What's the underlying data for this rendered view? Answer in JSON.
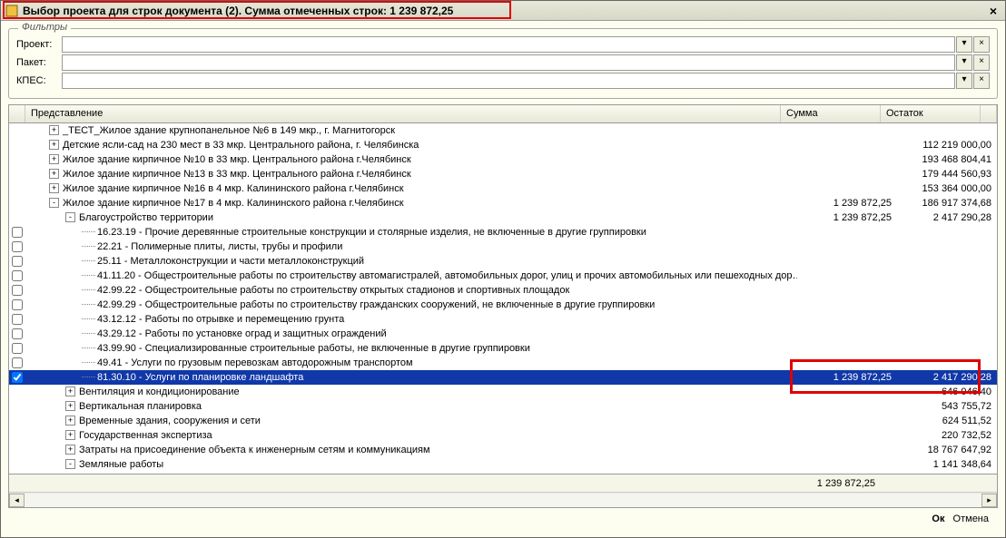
{
  "title": "Выбор проекта для строк документа (2). Сумма отмеченных строк: 1 239 872,25",
  "filters": {
    "legend": "Фильтры",
    "project_label": "Проект:",
    "packet_label": "Пакет:",
    "kpes_label": "КПЕС:",
    "project_value": "",
    "packet_value": "",
    "kpes_value": ""
  },
  "columns": {
    "name": "Представление",
    "sum": "Сумма",
    "remain": "Остаток"
  },
  "rows": [
    {
      "indent": 1,
      "exp": "+",
      "check": false,
      "text": "_ТЕСТ_Жилое здание крупнопанельное №6 в 149 мкр., г. Магнитогорск",
      "sum": "",
      "rem": ""
    },
    {
      "indent": 1,
      "exp": "+",
      "check": false,
      "text": "Детские ясли-сад на 230 мест в 33 мкр. Центрального района, г. Челябинска",
      "sum": "",
      "rem": "112 219 000,00"
    },
    {
      "indent": 1,
      "exp": "+",
      "check": false,
      "text": "Жилое здание кирпичное №10 в 33 мкр. Центрального района г.Челябинск",
      "sum": "",
      "rem": "193 468 804,41"
    },
    {
      "indent": 1,
      "exp": "+",
      "check": false,
      "text": "Жилое здание кирпичное №13 в 33 мкр. Центрального района г.Челябинск",
      "sum": "",
      "rem": "179 444 560,93"
    },
    {
      "indent": 1,
      "exp": "+",
      "check": false,
      "text": "Жилое здание кирпичное №16 в 4 мкр. Калининского района г.Челябинск",
      "sum": "",
      "rem": "153 364 000,00"
    },
    {
      "indent": 1,
      "exp": "-",
      "check": false,
      "text": "Жилое здание кирпичное №17 в 4 мкр. Калининского района г.Челябинск",
      "sum": "1 239 872,25",
      "rem": "186 917 374,68"
    },
    {
      "indent": 2,
      "exp": "-",
      "check": false,
      "text": "Благоустройство территории",
      "sum": "1 239 872,25",
      "rem": "2 417 290,28"
    },
    {
      "indent": 3,
      "exp": "",
      "check": false,
      "text": "16.23.19 - Прочие деревянные строительные конструкции и столярные изделия, не включенные в другие группировки",
      "sum": "",
      "rem": ""
    },
    {
      "indent": 3,
      "exp": "",
      "check": false,
      "text": "22.21 - Полимерные плиты, листы, трубы и профили",
      "sum": "",
      "rem": ""
    },
    {
      "indent": 3,
      "exp": "",
      "check": false,
      "text": "25.11 - Металлоконструкции и части металлоконструкций",
      "sum": "",
      "rem": ""
    },
    {
      "indent": 3,
      "exp": "",
      "check": false,
      "text": "41.11.20 - Общестроительные работы по строительству автомагистралей, автомобильных дорог, улиц и прочих автомобильных или пешеходных дор…",
      "sum": "",
      "rem": ""
    },
    {
      "indent": 3,
      "exp": "",
      "check": false,
      "text": "42.99.22 - Общестроительные работы по строительству открытых стадионов и спортивных площадок",
      "sum": "",
      "rem": ""
    },
    {
      "indent": 3,
      "exp": "",
      "check": false,
      "text": "42.99.29 - Общестроительные работы по строительству гражданских сооружений, не включенные в другие группировки",
      "sum": "",
      "rem": ""
    },
    {
      "indent": 3,
      "exp": "",
      "check": false,
      "text": "43.12.12 - Работы по отрывке и перемещению грунта",
      "sum": "",
      "rem": ""
    },
    {
      "indent": 3,
      "exp": "",
      "check": false,
      "text": "43.29.12 - Работы по установке оград и защитных ограждений",
      "sum": "",
      "rem": ""
    },
    {
      "indent": 3,
      "exp": "",
      "check": false,
      "text": "43.99.90 - Специализированные строительные работы, не включенные в другие группировки",
      "sum": "",
      "rem": ""
    },
    {
      "indent": 3,
      "exp": "",
      "check": false,
      "text": "49.41 - Услуги по грузовым перевозкам автодорожным транспортом",
      "sum": "",
      "rem": ""
    },
    {
      "indent": 3,
      "exp": "",
      "check": true,
      "selected": true,
      "text": "81.30.10 - Услуги по планировке ландшафта",
      "sum": "1 239 872,25",
      "rem": "2 417 290,28"
    },
    {
      "indent": 2,
      "exp": "+",
      "check": false,
      "text": "Вентиляция и кондиционирование",
      "sum": "",
      "rem": "646 046,40"
    },
    {
      "indent": 2,
      "exp": "+",
      "check": false,
      "text": "Вертикальная планировка",
      "sum": "",
      "rem": "543 755,72"
    },
    {
      "indent": 2,
      "exp": "+",
      "check": false,
      "text": "Временные здания, сооружения и сети",
      "sum": "",
      "rem": "624 511,52"
    },
    {
      "indent": 2,
      "exp": "+",
      "check": false,
      "text": "Государственная экспертиза",
      "sum": "",
      "rem": "220 732,52"
    },
    {
      "indent": 2,
      "exp": "+",
      "check": false,
      "text": "Затраты на присоединение объекта к инженерным сетям и коммуникациям",
      "sum": "",
      "rem": "18 767 647,92"
    },
    {
      "indent": 2,
      "exp": "-",
      "check": false,
      "text": "Земляные работы",
      "sum": "",
      "rem": "1 141 348,64"
    }
  ],
  "footer_sum": "1 239 872,25",
  "buttons": {
    "ok": "Ок",
    "cancel": "Отмена"
  }
}
